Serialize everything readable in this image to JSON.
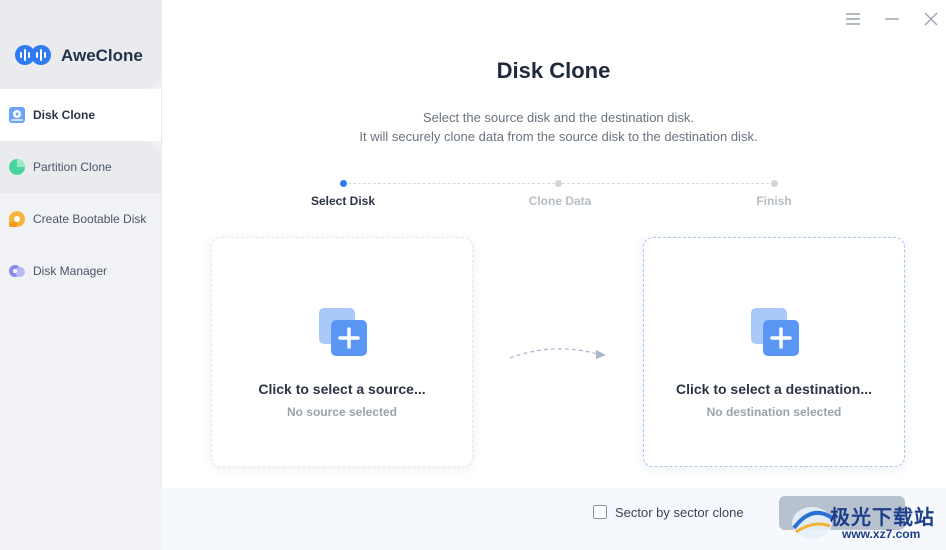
{
  "app": {
    "name": "AweClone"
  },
  "sidebar": {
    "items": [
      {
        "label": "Disk Clone",
        "active": true
      },
      {
        "label": "Partition Clone",
        "active": false
      },
      {
        "label": "Create Bootable Disk",
        "active": false
      },
      {
        "label": "Disk Manager",
        "active": false
      }
    ]
  },
  "main": {
    "title": "Disk Clone",
    "subtitle_line1": "Select the source disk and the destination disk.",
    "subtitle_line2": "It will securely clone data from the source disk to the destination disk.",
    "steps": [
      {
        "label": "Select Disk",
        "active": true
      },
      {
        "label": "Clone Data",
        "active": false
      },
      {
        "label": "Finish",
        "active": false
      }
    ],
    "source_card": {
      "title": "Click to select a source...",
      "status": "No source selected"
    },
    "dest_card": {
      "title": "Click to select a destination...",
      "status": "No destination selected"
    }
  },
  "footer": {
    "sector_clone_label": "Sector by sector clone",
    "sector_clone_checked": false
  },
  "watermark": {
    "text": "极光下载站",
    "url": "www.xz7.com"
  },
  "colors": {
    "accent": "#2f7bf6",
    "icon_blue": "#6aa3f8",
    "sidebar_bg": "#f1f2f5"
  }
}
